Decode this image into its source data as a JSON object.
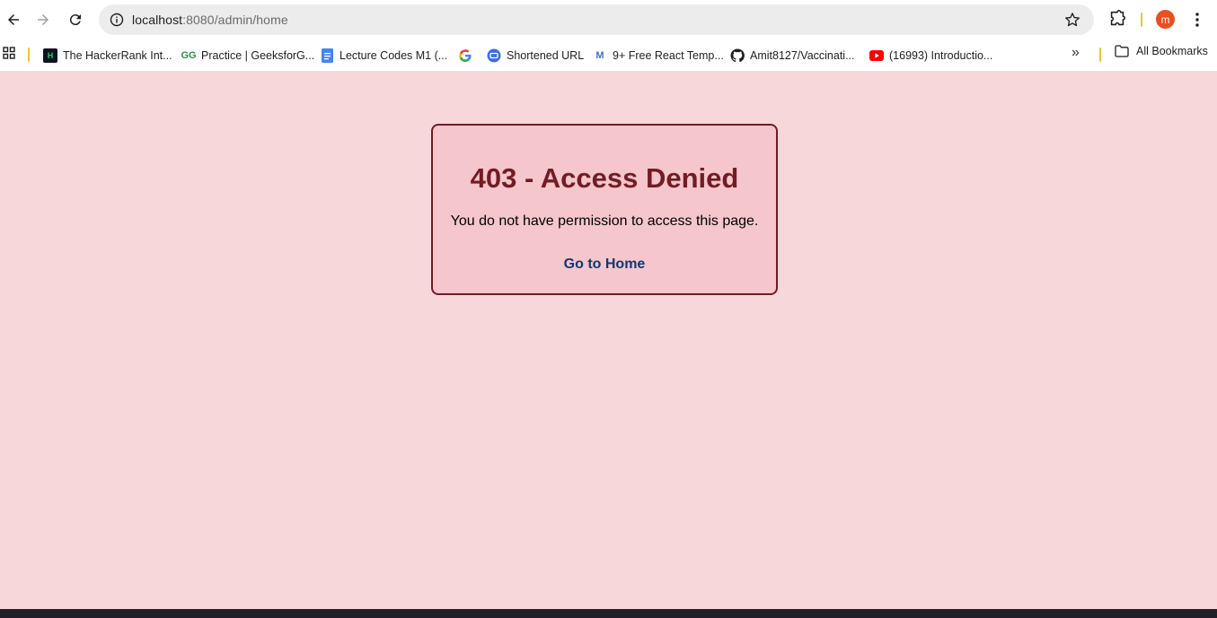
{
  "browser": {
    "url_host": "localhost",
    "url_rest": ":8080/admin/home",
    "profile_initial": "m",
    "bookmarks": [
      {
        "label": "The HackerRank Int...",
        "icon": "hackerrank-icon"
      },
      {
        "label": "Practice | GeeksforG...",
        "icon": "geeksforgeeks-icon"
      },
      {
        "label": "Lecture Codes M1 (...",
        "icon": "google-docs-icon"
      },
      {
        "label": "",
        "icon": "google-icon"
      },
      {
        "label": "Shortened URL",
        "icon": "link-shortener-icon"
      },
      {
        "label": "9+ Free React Temp...",
        "icon": "react-template-icon"
      },
      {
        "label": "Amit8127/Vaccinati...",
        "icon": "github-icon"
      },
      {
        "label": "(16993) Introductio...",
        "icon": "youtube-icon"
      }
    ],
    "all_bookmarks_label": "All Bookmarks"
  },
  "page": {
    "heading": "403 - Access Denied",
    "message": "You do not have permission to access this page.",
    "home_link": "Go to Home"
  },
  "colors": {
    "page_bg": "#f8d7da",
    "card_bg": "#f5c6cb",
    "card_border": "#721c24",
    "link": "#0a3a7a"
  }
}
